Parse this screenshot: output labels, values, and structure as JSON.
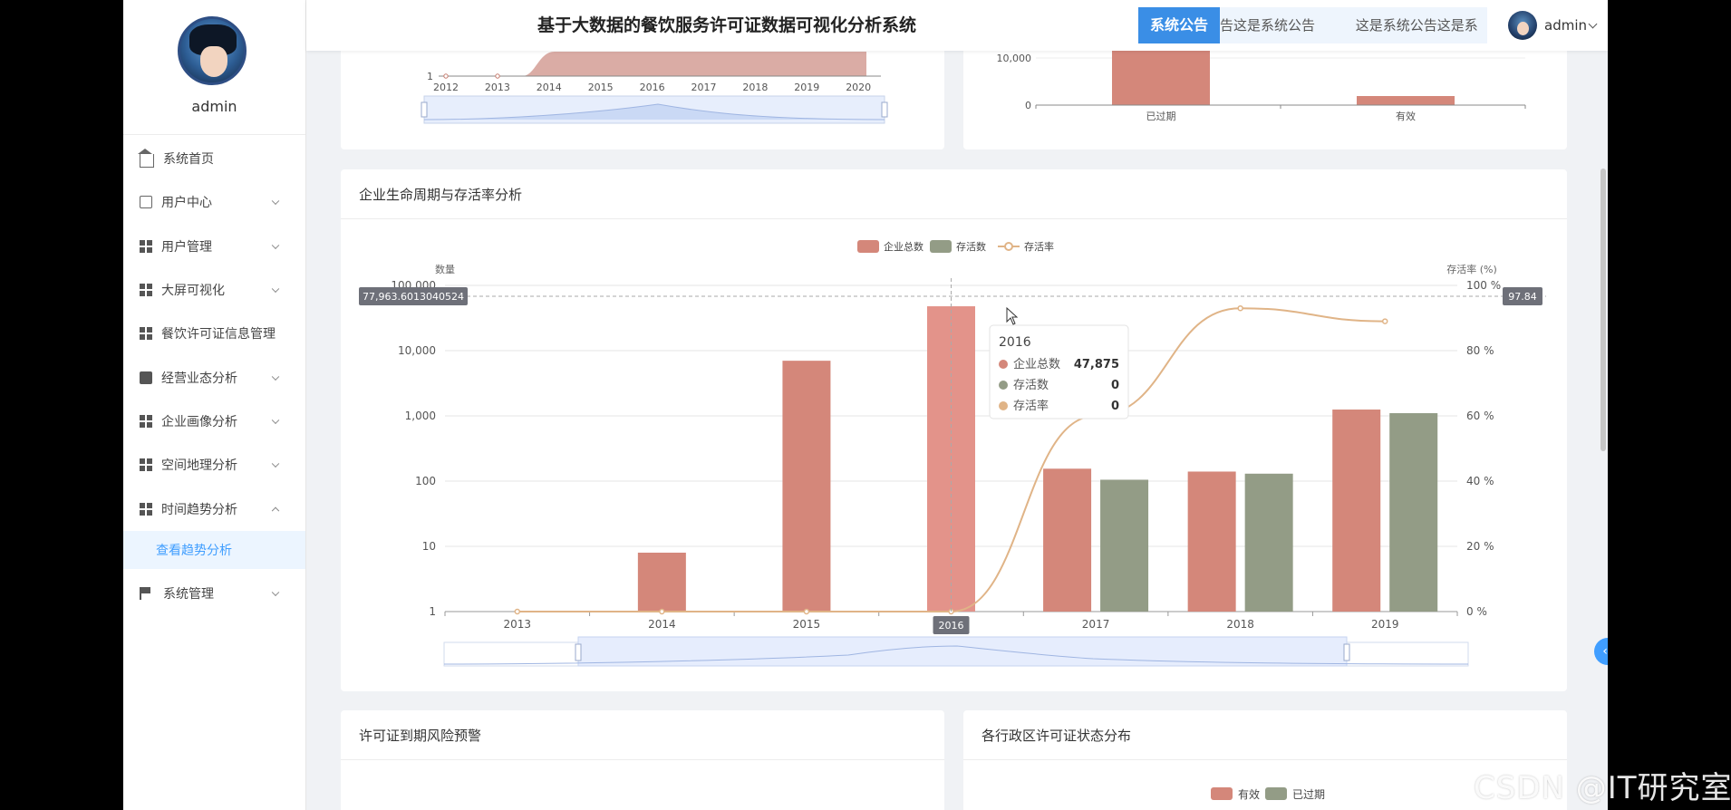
{
  "header": {
    "title": "基于大数据的餐饮服务许可证数据可视化分析系统",
    "notice_label": "系统公告",
    "notice_text": "告这是系统公告 这是系统公告这是系",
    "username": "admin"
  },
  "sidebar": {
    "username": "admin",
    "items": [
      {
        "label": "系统首页",
        "icon": "home-icon"
      },
      {
        "label": "用户中心",
        "icon": "card-icon"
      },
      {
        "label": "用户管理",
        "icon": "grid-icon"
      },
      {
        "label": "大屏可视化",
        "icon": "grid-icon"
      },
      {
        "label": "餐饮许可证信息管理",
        "icon": "grid-icon"
      },
      {
        "label": "经营业态分析",
        "icon": "ticket-icon"
      },
      {
        "label": "企业画像分析",
        "icon": "grid-icon"
      },
      {
        "label": "空间地理分析",
        "icon": "grid-icon"
      },
      {
        "label": "时间趋势分析",
        "icon": "grid-icon"
      },
      {
        "label": "系统管理",
        "icon": "flag-icon"
      }
    ],
    "submenu_item": "查看趋势分析"
  },
  "cards": {
    "main_title": "企业生命周期与存活率分析",
    "bottom_left_title": "许可证到期风险预警",
    "bottom_right_title": "各行政区许可证状态分布"
  },
  "top_left_chart": {
    "y_tick": "1",
    "x_ticks": [
      "2012",
      "2013",
      "2014",
      "2015",
      "2016",
      "2017",
      "2018",
      "2019",
      "2020"
    ]
  },
  "top_right_chart": {
    "y_ticks": [
      "10,000",
      "0"
    ],
    "categories": [
      "已过期",
      "有效"
    ]
  },
  "bottom_right_legend": [
    "有效",
    "已过期"
  ],
  "chart_data": {
    "type": "bar",
    "categories": [
      "2013",
      "2014",
      "2015",
      "2016",
      "2017",
      "2018",
      "2019"
    ],
    "series": [
      {
        "name": "企业总数",
        "type": "bar",
        "values": [
          1,
          8,
          7000,
          47875,
          155,
          140,
          1250
        ],
        "color": "#d4877a"
      },
      {
        "name": "存活数",
        "type": "bar",
        "values": [
          0,
          0,
          0,
          0,
          105,
          130,
          1100
        ],
        "color": "#939c86"
      },
      {
        "name": "存活率",
        "type": "line",
        "values": [
          0,
          0,
          0,
          0,
          60,
          93,
          89
        ],
        "color": "#e0b487"
      }
    ],
    "ylabel_left": "数量",
    "ylabel_right": "存活率 (%)",
    "y_left_scale": "log",
    "y_left_ticks": [
      "1",
      "10",
      "100",
      "1,000",
      "10,000",
      "100,000"
    ],
    "y_right_ticks": [
      "0 %",
      "20 %",
      "40 %",
      "60 %",
      "80 %",
      "100 %"
    ],
    "ylim_right": [
      0,
      100
    ],
    "legend_position": "top-center",
    "grid": true,
    "pointer_label_left": "77,963.6013040524",
    "pointer_label_right": "97.84",
    "pointer_label_x": "2016",
    "tooltip": {
      "title": "2016",
      "rows": [
        {
          "name": "企业总数",
          "value": "47,875"
        },
        {
          "name": "存活数",
          "value": "0"
        },
        {
          "name": "存活率",
          "value": "0"
        }
      ]
    }
  }
}
